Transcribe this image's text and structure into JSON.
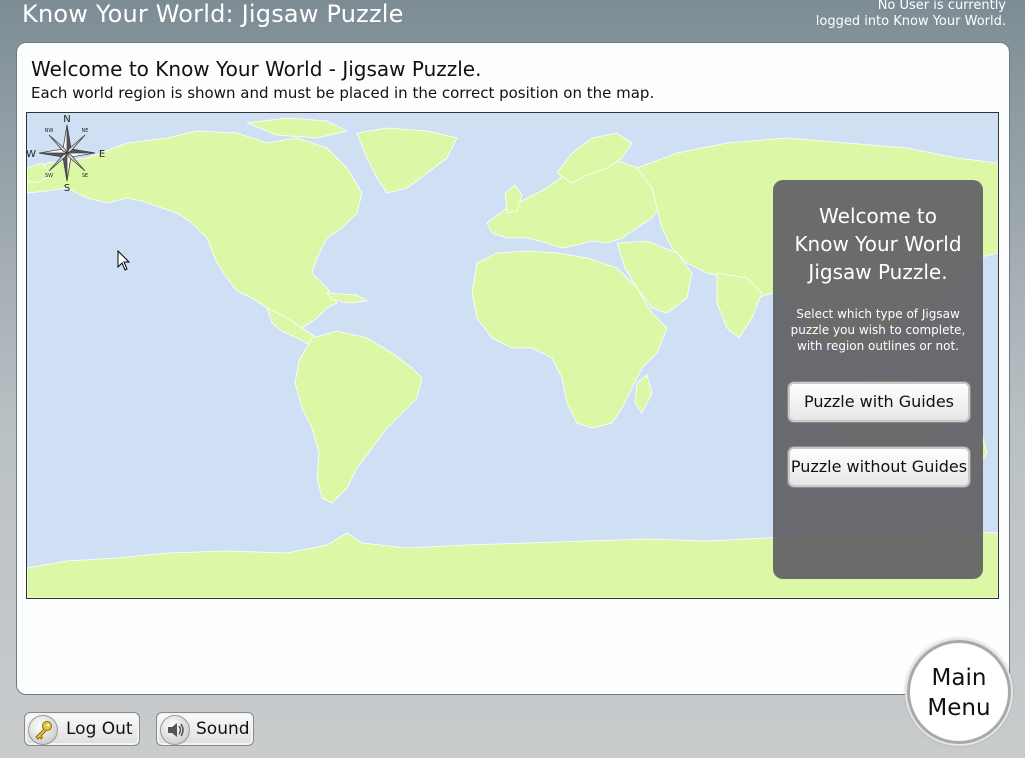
{
  "app": {
    "title": "Know Your World: Jigsaw Puzzle",
    "user_status_line1": "No User is currently",
    "user_status_line2": "logged into Know Your World."
  },
  "welcome": {
    "title": "Welcome to Know Your World - Jigsaw Puzzle.",
    "subtitle": "Each world region is shown and must be placed in the correct position on the map."
  },
  "map": {
    "compass": {
      "n": "N",
      "s": "S",
      "e": "E",
      "w": "W",
      "ne": "NE",
      "nw": "NW",
      "se": "SE",
      "sw": "SW"
    },
    "colors": {
      "ocean": "#cfe0f5",
      "land": "#dcf7a6",
      "border": "#ffffff"
    }
  },
  "overlay": {
    "title": "Welcome to\nKnow Your World\nJigsaw Puzzle.",
    "description": "Select which type of Jigsaw puzzle you wish to complete, with region outlines or not.",
    "buttons": {
      "with_guides": "Puzzle with Guides",
      "without_guides": "Puzzle without Guides"
    }
  },
  "footer": {
    "logout_label": "Log Out",
    "sound_label": "Sound",
    "main_menu_line1": "Main",
    "main_menu_line2": "Menu"
  },
  "icons": {
    "logout": "key-icon",
    "sound": "speaker-icon",
    "compass": "compass-rose-icon",
    "cursor": "mouse-pointer-icon"
  }
}
